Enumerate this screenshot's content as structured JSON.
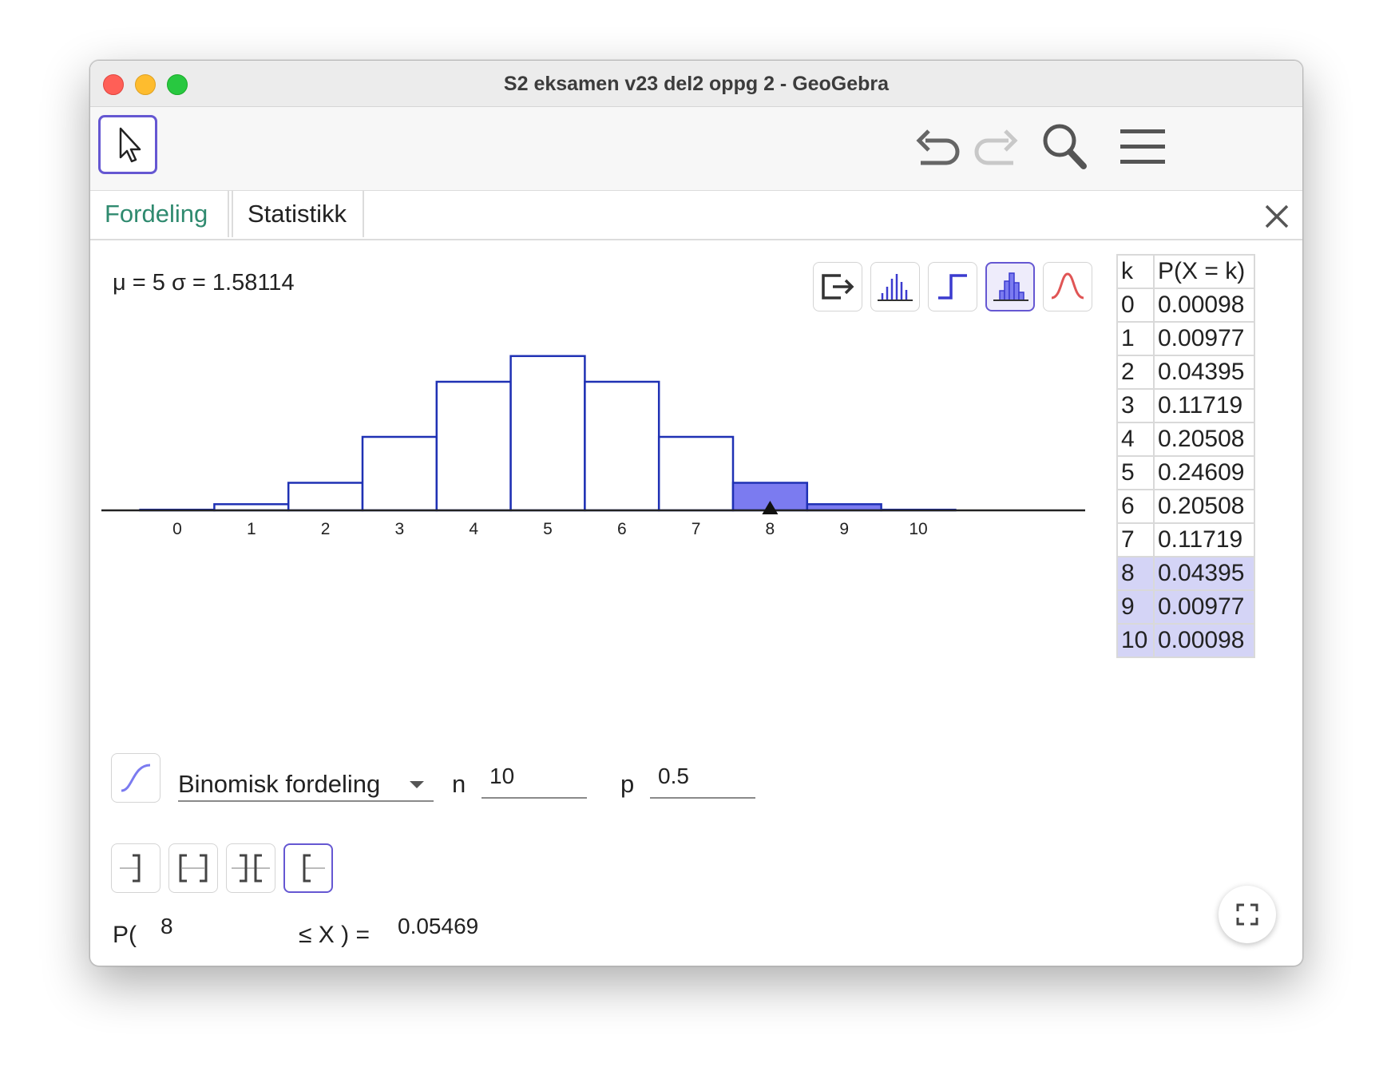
{
  "window": {
    "title": "S2 eksamen v23 del2 oppg 2 - GeoGebra"
  },
  "tabs": [
    {
      "label": "Fordeling"
    },
    {
      "label": "Statistikk"
    }
  ],
  "stats": {
    "summary": "μ = 5 σ = 1.58114"
  },
  "distribution": {
    "name": "Binomisk fordeling",
    "n_label": "n",
    "n_value": "10",
    "p_label": "p",
    "p_value": "0.5"
  },
  "probability": {
    "prefix": "P(",
    "lower": "8",
    "suffix": "≤ X ) =",
    "result": "0.05469"
  },
  "table": {
    "headers": [
      "k",
      "P(X = k)"
    ],
    "rows": [
      {
        "k": "0",
        "p": "0.00098"
      },
      {
        "k": "1",
        "p": "0.00977"
      },
      {
        "k": "2",
        "p": "0.04395"
      },
      {
        "k": "3",
        "p": "0.11719"
      },
      {
        "k": "4",
        "p": "0.20508"
      },
      {
        "k": "5",
        "p": "0.24609"
      },
      {
        "k": "6",
        "p": "0.20508"
      },
      {
        "k": "7",
        "p": "0.11719"
      },
      {
        "k": "8",
        "p": "0.04395"
      },
      {
        "k": "9",
        "p": "0.00977"
      },
      {
        "k": "10",
        "p": "0.00098"
      }
    ],
    "highlight_from_k": 8
  },
  "chart_data": {
    "type": "bar",
    "categories": [
      "0",
      "1",
      "2",
      "3",
      "4",
      "5",
      "6",
      "7",
      "8",
      "9",
      "10"
    ],
    "values": [
      0.00098,
      0.00977,
      0.04395,
      0.11719,
      0.20508,
      0.24609,
      0.20508,
      0.11719,
      0.04395,
      0.00977,
      0.00098
    ],
    "highlighted": [
      "8",
      "9",
      "10"
    ],
    "marker_at": "8",
    "xlim": [
      -1,
      11
    ],
    "ylim": [
      0,
      0.25
    ],
    "bar_color": "#1f31b4",
    "highlight_color": "#7b7bf0"
  },
  "colors": {
    "accent": "#6557d2",
    "tab_active": "#2f8a6f",
    "bar_outline": "#1f31b4",
    "bar_highlight": "#7b7bf0",
    "table_highlight": "#d4d4f6"
  },
  "icons": [
    "move-tool-icon",
    "undo-icon",
    "redo-icon",
    "search-icon",
    "menu-icon",
    "close-icon",
    "export-icon",
    "bar-graph-icon",
    "step-graph-icon",
    "histogram-icon",
    "normal-curve-icon",
    "cumulative-icon",
    "left-sided-icon",
    "interval-icon",
    "two-tailed-icon",
    "right-sided-icon",
    "fullscreen-icon"
  ]
}
